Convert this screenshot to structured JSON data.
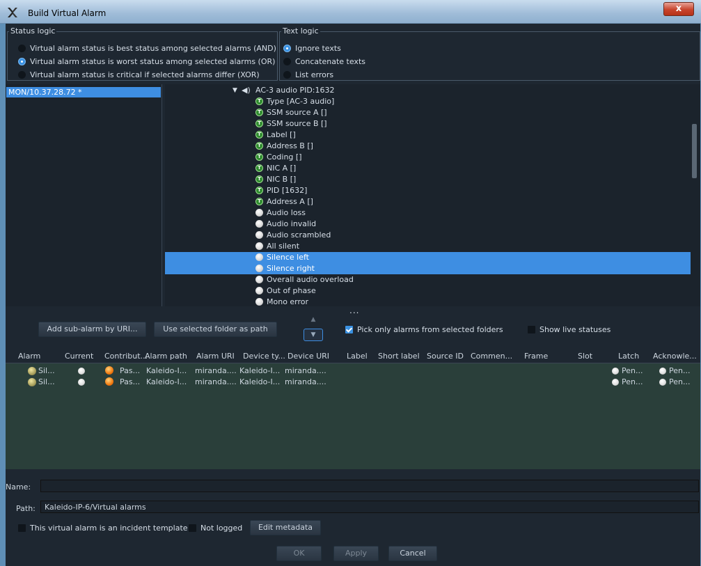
{
  "window": {
    "title": "Build Virtual Alarm",
    "close_label": "x"
  },
  "status_logic": {
    "legend": "Status logic",
    "options": [
      {
        "label": "Virtual alarm status is best status among selected alarms (AND)",
        "selected": false
      },
      {
        "label": "Virtual alarm status is worst status among selected alarms (OR)",
        "selected": true
      },
      {
        "label": "Virtual alarm status is critical if selected alarms differ (XOR)",
        "selected": false
      }
    ]
  },
  "text_logic": {
    "legend": "Text logic",
    "options": [
      {
        "label": "Ignore texts",
        "selected": true
      },
      {
        "label": "Concatenate texts",
        "selected": false
      },
      {
        "label": "List errors",
        "selected": false
      }
    ]
  },
  "folders": {
    "selected": "MON/10.37.28.72 *"
  },
  "tree": {
    "root": "AC-3 audio PID:1632",
    "items": [
      {
        "label": "Type [AC-3 audio]",
        "icon": "text-alarm-icon",
        "selected": false
      },
      {
        "label": "SSM source A []",
        "icon": "text-alarm-icon",
        "selected": false
      },
      {
        "label": "SSM source B []",
        "icon": "text-alarm-icon",
        "selected": false
      },
      {
        "label": "Label []",
        "icon": "text-alarm-icon",
        "selected": false
      },
      {
        "label": "Address B []",
        "icon": "text-alarm-icon",
        "selected": false
      },
      {
        "label": "Coding []",
        "icon": "text-alarm-icon",
        "selected": false
      },
      {
        "label": "NIC A []",
        "icon": "text-alarm-icon",
        "selected": false
      },
      {
        "label": "NIC B []",
        "icon": "text-alarm-icon",
        "selected": false
      },
      {
        "label": "PID [1632]",
        "icon": "text-alarm-icon",
        "selected": false
      },
      {
        "label": "Address A []",
        "icon": "text-alarm-icon",
        "selected": false
      },
      {
        "label": "Audio loss",
        "icon": "status-ball-icon",
        "selected": false
      },
      {
        "label": "Audio invalid",
        "icon": "status-ball-icon",
        "selected": false
      },
      {
        "label": "Audio scrambled",
        "icon": "status-ball-icon",
        "selected": false
      },
      {
        "label": "All silent",
        "icon": "status-ball-icon",
        "selected": false
      },
      {
        "label": "Silence left",
        "icon": "status-ball-icon",
        "selected": true
      },
      {
        "label": "Silence right",
        "icon": "status-ball-icon",
        "selected": true
      },
      {
        "label": "Overall audio overload",
        "icon": "status-ball-icon",
        "selected": false
      },
      {
        "label": "Out of phase",
        "icon": "status-ball-icon",
        "selected": false
      },
      {
        "label": "Mono error",
        "icon": "status-ball-icon",
        "selected": false
      }
    ]
  },
  "splitter_dots": "...",
  "actions": {
    "add_sub_alarm": "Add sub-alarm by URI...",
    "use_selected_folder": "Use selected folder as path",
    "pick_only": "Pick only alarms from selected folders",
    "pick_only_checked": true,
    "show_live": "Show live statuses",
    "show_live_checked": false
  },
  "table": {
    "headers": [
      "Alarm",
      "Current",
      "Contribut...",
      "Alarm path",
      "Alarm URI",
      "Device ty...",
      "Device URI",
      "Label",
      "Short label",
      "Source ID",
      "Commen...",
      "Frame",
      "Slot",
      "Latch",
      "Acknowle..."
    ],
    "rows": [
      {
        "alarm": "Sil...",
        "contrib": "Pas...",
        "path": "Kaleido-I...",
        "uri": "miranda....",
        "devtype": "Kaleido-I...",
        "devuri": "miranda....",
        "latch": "Pen...",
        "ack": "Pen..."
      },
      {
        "alarm": "Sil...",
        "contrib": "Pas...",
        "path": "Kaleido-I...",
        "uri": "miranda....",
        "devtype": "Kaleido-I...",
        "devuri": "miranda....",
        "latch": "Pen...",
        "ack": "Pen..."
      }
    ]
  },
  "form": {
    "name_label": "Name:",
    "name_value": "",
    "path_label": "Path:",
    "path_value": "Kaleido-IP-6/Virtual alarms",
    "incident_template": "This virtual alarm is an incident template",
    "not_logged": "Not logged",
    "edit_metadata": "Edit metadata"
  },
  "footer": {
    "ok": "OK",
    "apply": "Apply",
    "cancel": "Cancel"
  },
  "colors": {
    "accent": "#3e8ee2",
    "background": "#1e2731",
    "table_bg": "#2a3f3a"
  }
}
